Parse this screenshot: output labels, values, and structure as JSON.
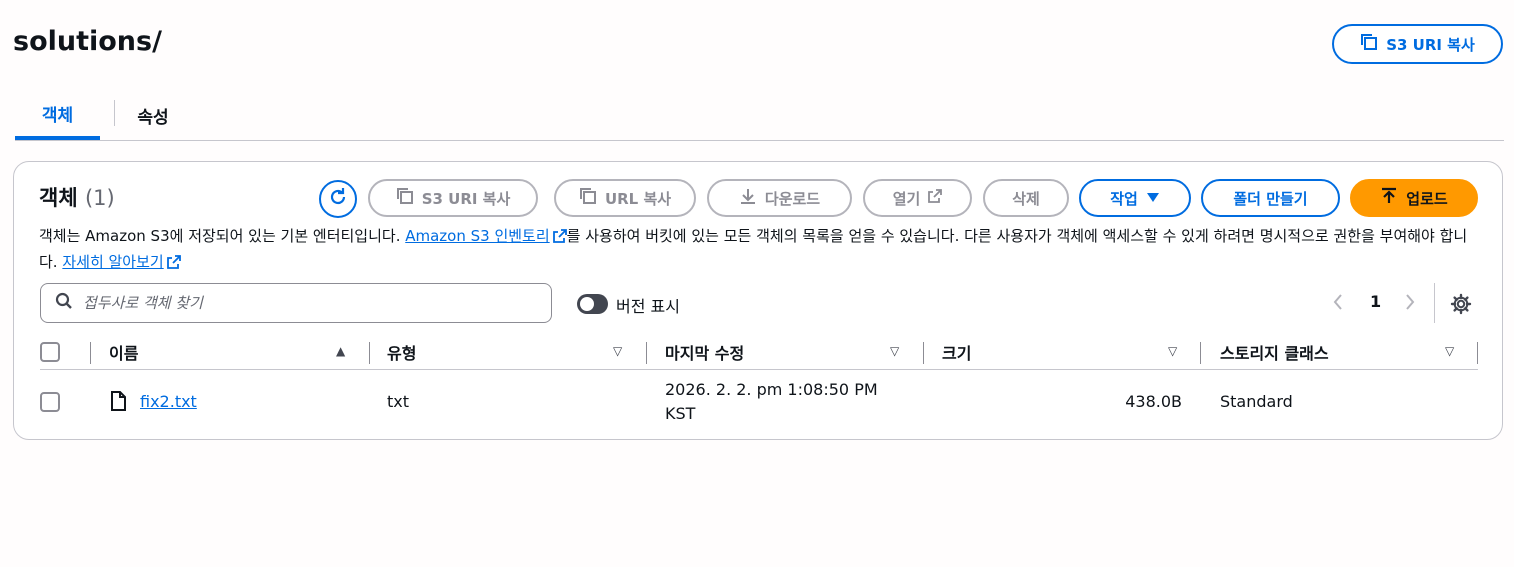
{
  "header": {
    "title": "solutions/",
    "copy_uri_label": "S3 URI 복사"
  },
  "tabs": [
    {
      "label": "객체",
      "active": true
    },
    {
      "label": "속성",
      "active": false
    }
  ],
  "panel": {
    "title": "객체",
    "count": "(1)",
    "toolbar": {
      "copy_uri": "S3 URI 복사",
      "copy_url": "URL 복사",
      "download": "다운로드",
      "open": "열기",
      "delete": "삭제",
      "actions": "작업",
      "create_folder": "폴더 만들기",
      "upload": "업로드"
    },
    "description": {
      "part1": "객체는 Amazon S3에 저장되어 있는 기본 엔터티입니다. ",
      "link1": "Amazon S3 인벤토리",
      "part2": "를 사용하여 버킷에 있는 모든 객체의 목록을 얻을 수 있습니다. 다른 사용자가 객체에 액세스할 수 있게 하려면 명시적으로 권한을 부여해야 합니다. ",
      "link2": "자세히 알아보기"
    },
    "search_placeholder": "접두사로 객체 찾기",
    "show_versions_label": "버전 표시",
    "show_versions": false,
    "page": "1"
  },
  "table": {
    "columns": [
      "이름",
      "유형",
      "마지막 수정",
      "크기",
      "스토리지 클래스"
    ],
    "rows": [
      {
        "name": "fix2.txt",
        "type": "txt",
        "modified_line1": "2026. 2. 2. pm 1:08:50 PM",
        "modified_line2": "KST",
        "size": "438.0B",
        "storage_class": "Standard"
      }
    ]
  },
  "colors": {
    "accent": "#006ce0",
    "upload": "#ff9900",
    "disabled": "#8c8c94"
  }
}
